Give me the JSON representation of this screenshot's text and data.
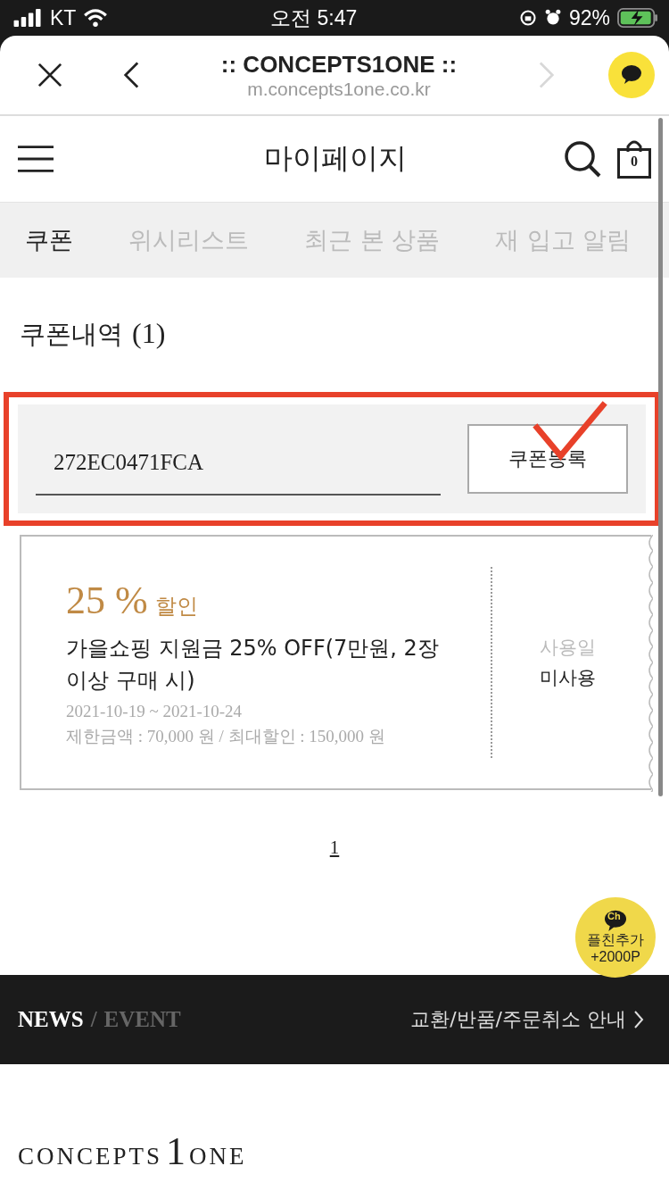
{
  "status_bar": {
    "carrier": "KT",
    "time": "오전 5:47",
    "battery": "92%"
  },
  "browser": {
    "title": ":: CONCEPTS1ONE ::",
    "url": "m.concepts1one.co.kr",
    "forward_disabled": true
  },
  "header": {
    "title": "마이페이지",
    "cart_count": "0"
  },
  "tabs": [
    {
      "label": "쿠폰",
      "selected": true
    },
    {
      "label": "위시리스트",
      "selected": false
    },
    {
      "label": "최근 본 상품",
      "selected": false
    },
    {
      "label": "재 입고 알림",
      "selected": false
    }
  ],
  "section": {
    "title": "쿠폰내역",
    "count": "(1)"
  },
  "coupon_form": {
    "value": "272EC0471FCA",
    "button": "쿠폰등록",
    "highlighted": true
  },
  "coupons": [
    {
      "rate": "25 %",
      "rate_suffix": "할인",
      "name": "가을쇼핑 지원금 25% OFF(7만원, 2장이상 구매 시)",
      "period": "2021-10-19 ~ 2021-10-24",
      "limits": "제한금액 : 70,000 원 / 최대할인 : 150,000 원",
      "status_label": "사용일",
      "status": "미사용"
    }
  ],
  "pagination": [
    {
      "label": "1",
      "selected": true
    }
  ],
  "floating_badge": {
    "icon_text": "Ch",
    "line1": "플친추가",
    "line2": "+2000P"
  },
  "footer": {
    "news": "NEWS",
    "separator": "/",
    "event": "EVENT",
    "link": "교환/반품/주문취소 안내"
  },
  "logo": {
    "left": "CONCEPTS",
    "middle": "1",
    "right": "ONE"
  }
}
